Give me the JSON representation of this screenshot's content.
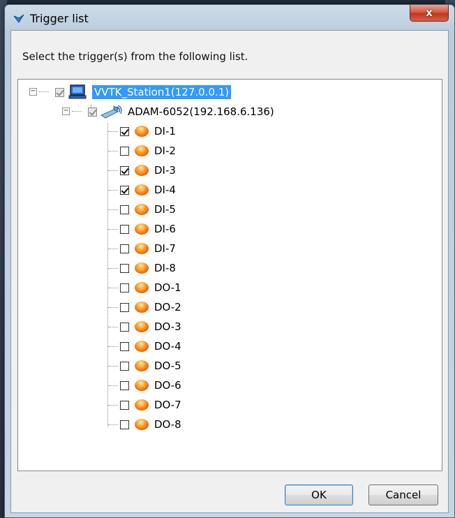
{
  "window": {
    "title": "Trigger list",
    "close_label": "x"
  },
  "prompt": "Select the trigger(s) from the following list.",
  "tree": {
    "station": {
      "label": "VVTK_Station1(127.0.0.1)",
      "checked": "partial",
      "expanded": true,
      "selected": true,
      "icon": "computer-icon"
    },
    "device": {
      "label": "ADAM-6052(192.168.6.136)",
      "checked": "partial",
      "expanded": true,
      "icon": "network-device-icon"
    },
    "channels": [
      {
        "label": "DI-1",
        "checked": true
      },
      {
        "label": "DI-2",
        "checked": false
      },
      {
        "label": "DI-3",
        "checked": true
      },
      {
        "label": "DI-4",
        "checked": true
      },
      {
        "label": "DI-5",
        "checked": false
      },
      {
        "label": "DI-6",
        "checked": false
      },
      {
        "label": "DI-7",
        "checked": false
      },
      {
        "label": "DI-8",
        "checked": false
      },
      {
        "label": "DO-1",
        "checked": false
      },
      {
        "label": "DO-2",
        "checked": false
      },
      {
        "label": "DO-3",
        "checked": false
      },
      {
        "label": "DO-4",
        "checked": false
      },
      {
        "label": "DO-5",
        "checked": false
      },
      {
        "label": "DO-6",
        "checked": false
      },
      {
        "label": "DO-7",
        "checked": false
      },
      {
        "label": "DO-8",
        "checked": false
      }
    ]
  },
  "buttons": {
    "ok": "OK",
    "cancel": "Cancel"
  },
  "colors": {
    "selection": "#3399ff",
    "orb": "#e8650a",
    "close": "#c2371d"
  }
}
